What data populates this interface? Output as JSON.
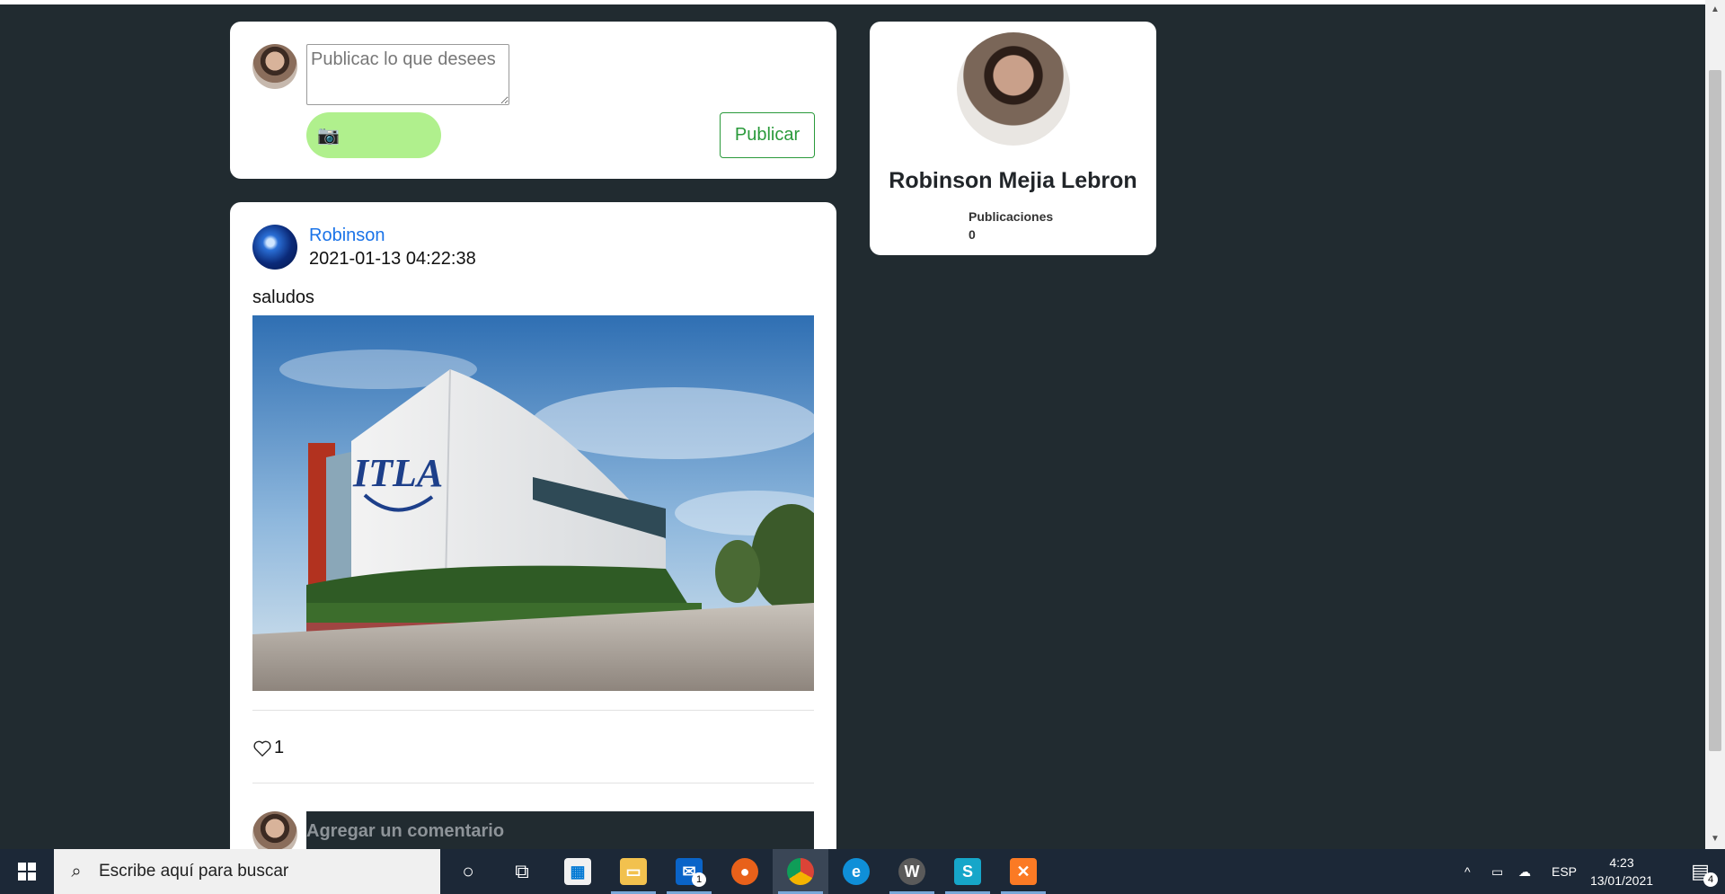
{
  "composer": {
    "placeholder": "Publicac lo que desees",
    "photo_icon": "camera-icon",
    "photo_glyph": "📷",
    "publish_label": "Publicar"
  },
  "post": {
    "author": "Robinson",
    "date": "2021-01-13 04:22:38",
    "text": "saludos",
    "image_desc_icon": "itla-building-photo",
    "image_sign": "ITLA",
    "like_count": "1",
    "comment_placeholder": "Agregar un comentario"
  },
  "profile": {
    "name": "Robinson Mejia Lebron",
    "stat_label": "Publicaciones",
    "stat_value": "0"
  },
  "taskbar": {
    "search_placeholder": "Escribe aquí para buscar",
    "language": "ESP",
    "time": "4:23",
    "date": "13/01/2021",
    "notification_count": "4",
    "mail_badge": "1",
    "icons": [
      "cortana-icon",
      "task-view-icon",
      "store-icon",
      "file-explorer-icon",
      "mail-icon",
      "firefox-icon",
      "chrome-icon",
      "edge-icon",
      "wamp-icon",
      "sublime-icon",
      "xampp-icon"
    ]
  },
  "colors": {
    "background": "#212b30",
    "card": "#ffffff",
    "link": "#1a73e8",
    "publish_green": "#2a9a3b",
    "photo_button": "#b0f08d",
    "taskbar": "#1c2837"
  }
}
